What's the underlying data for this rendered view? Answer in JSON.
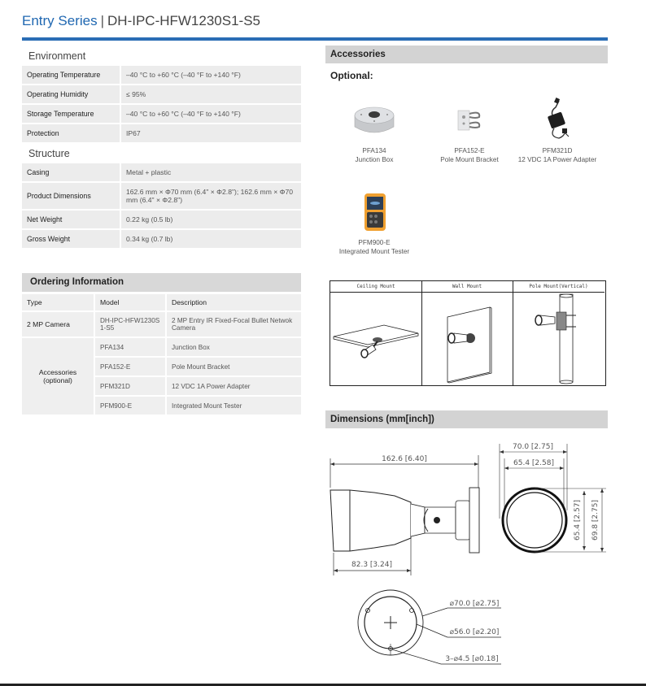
{
  "header": {
    "series": "Entry Series",
    "separator": "|",
    "model": "DH-IPC-HFW1230S1-S5"
  },
  "environment": {
    "title": "Environment",
    "rows": [
      {
        "label": "Operating Temperature",
        "value": "–40 °C to +60 °C (–40 °F to +140 °F)"
      },
      {
        "label": "Operating Humidity",
        "value": "≤ 95%"
      },
      {
        "label": "Storage Temperature",
        "value": "–40 °C to +60 °C (–40 °F to +140 °F)"
      },
      {
        "label": "Protection",
        "value": "IP67"
      }
    ]
  },
  "structure": {
    "title": "Structure",
    "rows": [
      {
        "label": "Casing",
        "value": "Metal + plastic"
      },
      {
        "label": "Product Dimensions",
        "value": "162.6 mm × Φ70 mm (6.4\" × Φ2.8\"); 162.6 mm × Φ70 mm (6.4\" × Φ2.8\")"
      },
      {
        "label": "Net Weight",
        "value": "0.22 kg (0.5 lb)"
      },
      {
        "label": "Gross Weight",
        "value": "0.34 kg (0.7 lb)"
      }
    ]
  },
  "ordering": {
    "title": "Ordering Information",
    "columns": [
      "Type",
      "Model",
      "Description"
    ],
    "camera": {
      "type": "2 MP Camera",
      "model": "DH-IPC-HFW1230S1-S5",
      "description": "2 MP Entry IR Fixed-Focal Bullet Netwok Camera"
    },
    "accessories_type": "Accessories (optional)",
    "accessories": [
      {
        "model": "PFA134",
        "description": "Junction Box"
      },
      {
        "model": "PFA152-E",
        "description": "Pole Mount Bracket"
      },
      {
        "model": "PFM321D",
        "description": "12 VDC 1A Power Adapter"
      },
      {
        "model": "PFM900-E",
        "description": "Integrated Mount Tester"
      }
    ]
  },
  "accessories": {
    "title": "Accessories",
    "subtitle": "Optional:",
    "items": [
      {
        "model": "PFA134",
        "name": "Junction Box",
        "icon": "junction-box-icon"
      },
      {
        "model": "PFA152-E",
        "name": "Pole Mount Bracket",
        "icon": "pole-bracket-icon"
      },
      {
        "model": "PFM321D",
        "name": "12 VDC 1A Power Adapter",
        "icon": "power-adapter-icon"
      },
      {
        "model": "PFM900-E",
        "name": "Integrated Mount Tester",
        "icon": "mount-tester-icon"
      }
    ]
  },
  "mounts": {
    "labels": [
      "Ceiling Mount",
      "Wall Mount",
      "Pole Mount(Vertical)"
    ]
  },
  "dimensions": {
    "title": "Dimensions (mm[inch])",
    "side_total_length": "162.6 [6.40]",
    "side_body_length": "82.3 [3.24]",
    "front_outer_width": "70.0 [2.75]",
    "front_inner_width": "65.4 [2.58]",
    "front_inner_height": "65.4 [2.57]",
    "front_outer_height": "69.8 [2.75]",
    "base_outer_dia": "⌀70.0 [⌀2.75]",
    "base_inner_dia": "⌀56.0 [⌀2.20]",
    "base_holes": "3–⌀4.5 [⌀0.18]"
  },
  "colors": {
    "accent": "#1f67b1",
    "rule": "#2a6db5",
    "row_bg": "#ececec",
    "bar_bg": "#d3d3d3"
  }
}
